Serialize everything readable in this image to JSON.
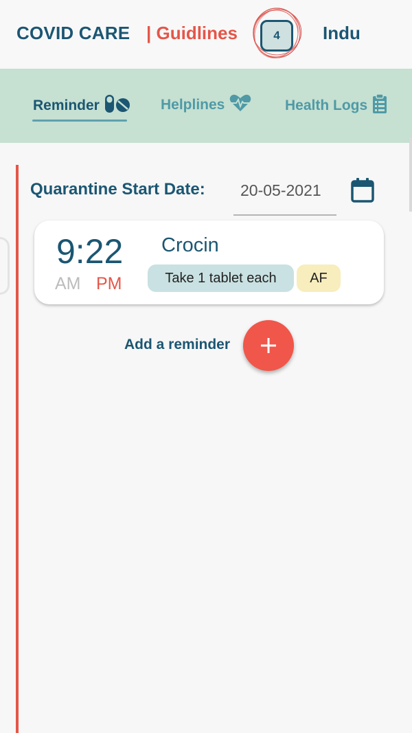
{
  "header": {
    "brand": "COVID CARE",
    "guidelines": "| Guidlines",
    "notification_count": "4",
    "user_name": "Indu"
  },
  "tabs": [
    {
      "label": "Reminder",
      "icon": "pills-icon",
      "active": true
    },
    {
      "label": "Helplines",
      "icon": "heartbeat-icon",
      "active": false
    },
    {
      "label": "Health Logs",
      "icon": "clipboard-icon",
      "active": false
    }
  ],
  "quarantine": {
    "label": "Quarantine Start Date:",
    "date": "20-05-2021"
  },
  "reminders": [
    {
      "time": "9:22",
      "am": "AM",
      "pm": "PM",
      "selected_period": "PM",
      "medicine": "Crocin",
      "dosage": "Take 1 tablet each",
      "timing": "AF"
    }
  ],
  "add_reminder": {
    "label": "Add a reminder",
    "button_symbol": "+"
  },
  "colors": {
    "primary": "#1b5672",
    "accent": "#e45649",
    "tab_bar": "#c6e0d2",
    "dosage_chip": "#c9e1e2",
    "timing_chip": "#f7edbd"
  }
}
